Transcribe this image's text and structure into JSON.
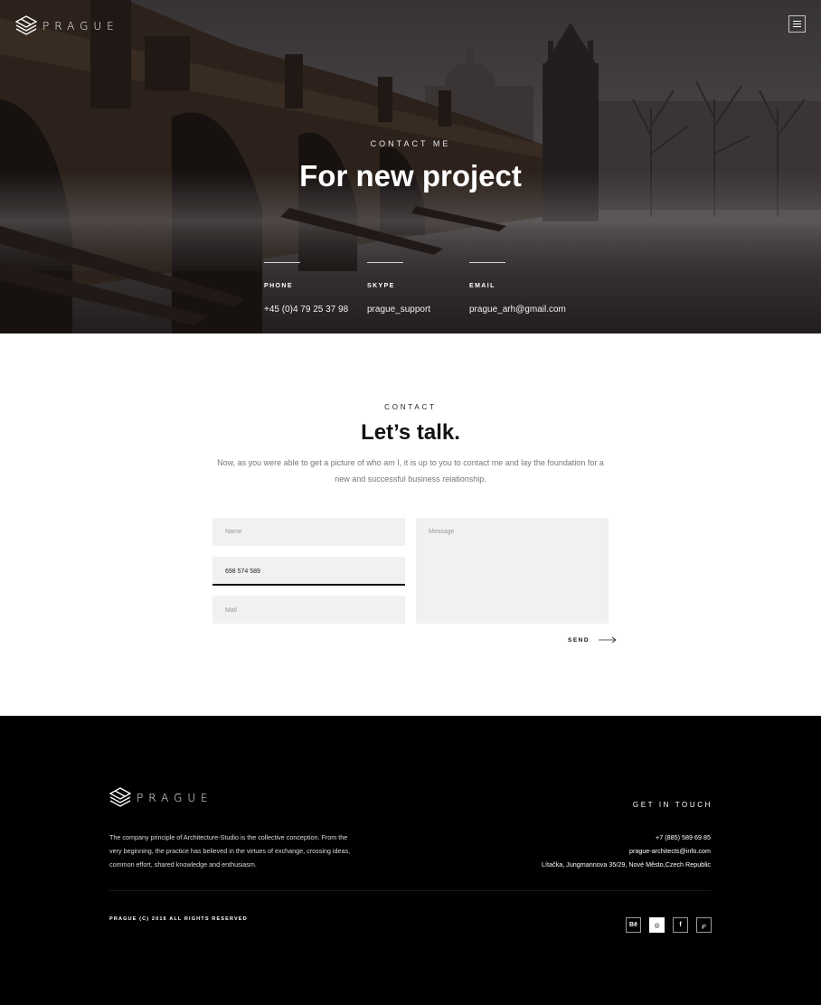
{
  "brand": {
    "name": "PRAGUE"
  },
  "hero": {
    "eyebrow": "CONTACT ME",
    "title": "For new project",
    "contacts": [
      {
        "label": "PHONE",
        "value": "+45 (0)4 79 25 37 98"
      },
      {
        "label": "SKYPE",
        "value": "prague_support"
      },
      {
        "label": "EMAIL",
        "value": "prague_arh@gmail.com"
      }
    ]
  },
  "contact": {
    "eyebrow": "CONTACT",
    "title": "Let’s talk.",
    "intro": "Now, as you were able to get a picture of who am I, it is up to you to contact me and lay the foundation for a new and successful business relationship.",
    "form": {
      "name_placeholder": "Name",
      "phone_value": "698 574 589",
      "mail_placeholder": "Mail",
      "message_placeholder": "Message",
      "send_label": "SEND"
    }
  },
  "footer": {
    "about": "The company principle of Architecture-Studio is the collective conception. From the very beginning, the practice has believed in the virtues of exchange, crossing ideas, common effort, shared knowledge and enthusiasm.",
    "get_in_touch": "GET IN TOUCH",
    "phone": "+7 (885) 589 69 85",
    "email": "prague-architects@info.com",
    "address": "Lítačka, Jungmannova 35/29, Nové Město,Czech Republic",
    "copyright": "PRAGUE (C) 2016 ALL RIGHTS RESERVED",
    "socials": [
      {
        "icon": "behance-icon",
        "glyph": "Bē"
      },
      {
        "icon": "dribbble-icon",
        "glyph": "◎",
        "active": true
      },
      {
        "icon": "facebook-icon",
        "glyph": "f"
      },
      {
        "icon": "pinterest-icon",
        "glyph": "℘"
      }
    ]
  }
}
